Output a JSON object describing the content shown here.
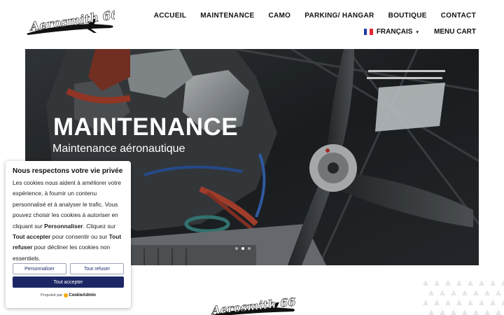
{
  "logo": {
    "text": "Aerosmith 66"
  },
  "nav": {
    "items": [
      "ACCUEIL",
      "MAINTENANCE",
      "CAMO",
      "PARKING/ HANGAR",
      "BOUTIQUE",
      "CONTACT"
    ],
    "language": "FRANÇAIS",
    "cart": "MENU CART"
  },
  "hero": {
    "title": "MAINTENANCE",
    "subtitle": "Maintenance aéronautique",
    "slides": 3,
    "active_slide": 2
  },
  "cookie": {
    "title": "Nous respectons votre vie privée",
    "text_1": "Les cookies nous aident à améliorer votre expérience, à fournir un contenu personnalisé et à analyser le trafic. Vous pouvez choisir les cookies à autoriser en cliquant sur ",
    "bold_1": "Personnaliser",
    "text_2": ". Cliquez sur ",
    "bold_2": "Tout accepter",
    "text_3": " pour consentir ou sur ",
    "bold_3": "Tout refuser",
    "text_4": " pour décliner les cookies non essentiels.",
    "btn_customize": "Personnaliser",
    "btn_reject": "Tout refuser",
    "btn_accept": "Tout accepter",
    "powered_by": "Propulsé par",
    "brand": "CookieAdmin"
  },
  "colors": {
    "accent": "#1e2766",
    "flag_blue": "#1f3aa8",
    "flag_red": "#e2262e"
  }
}
